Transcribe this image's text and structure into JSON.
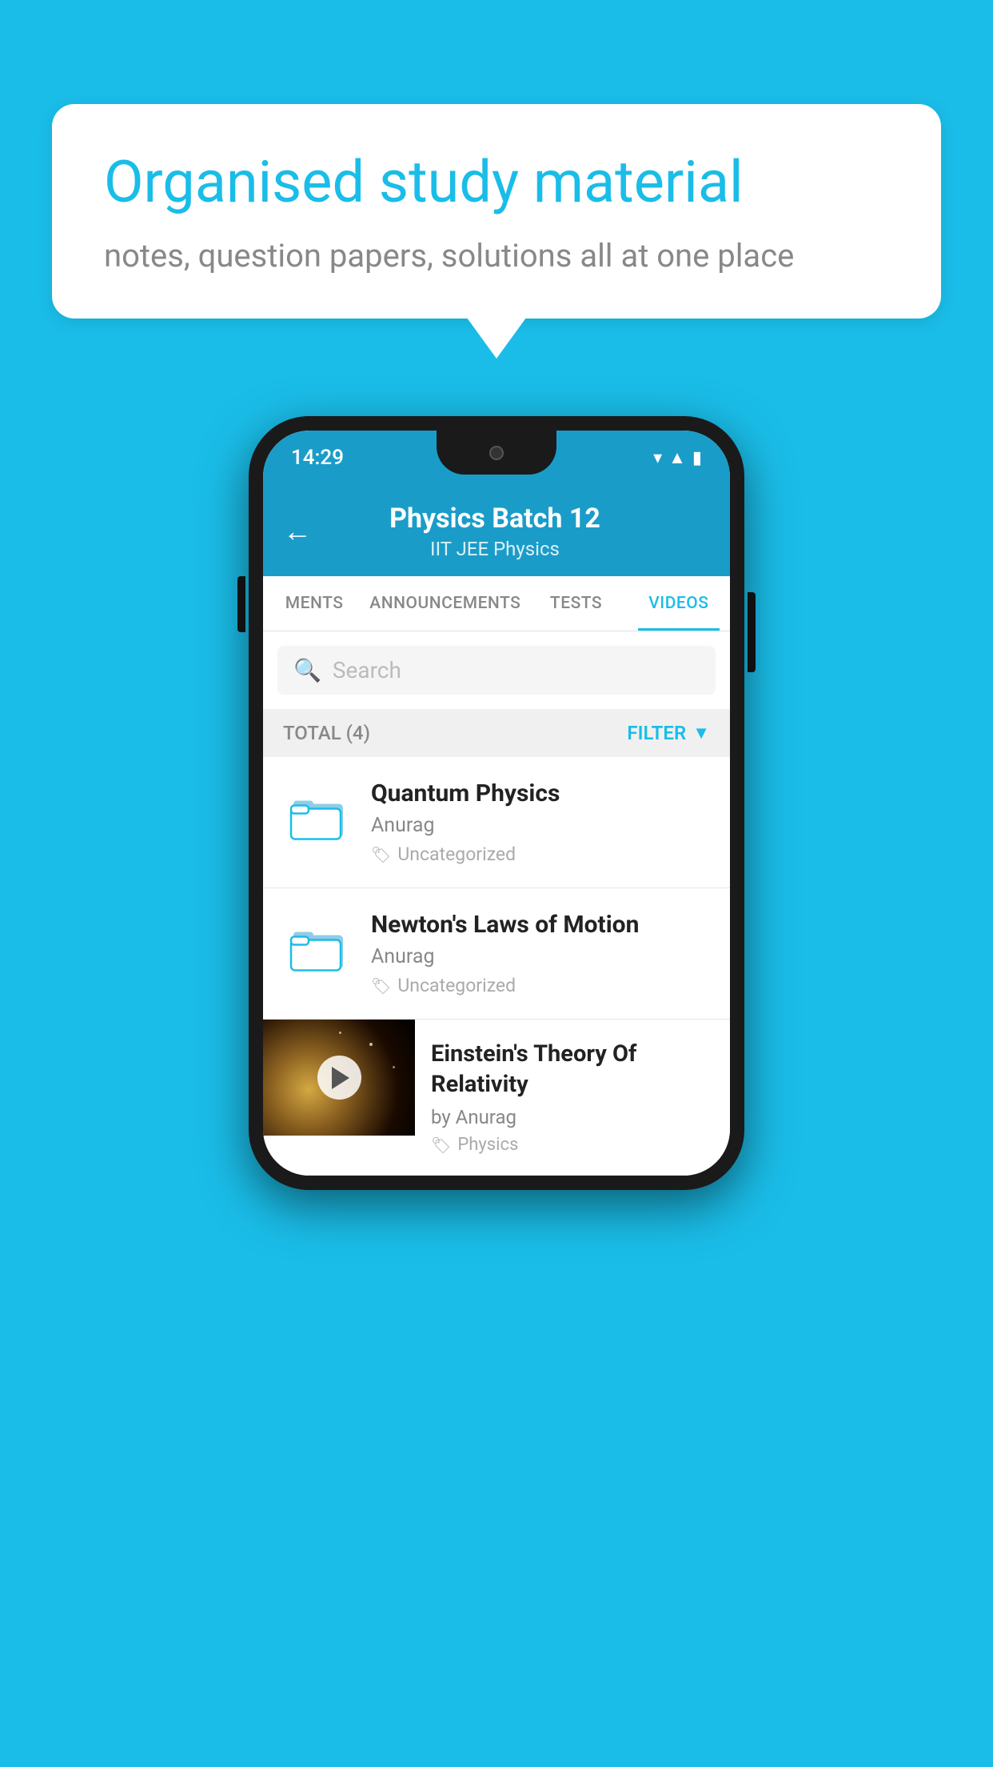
{
  "background_color": "#1abde8",
  "speech_bubble": {
    "title": "Organised study material",
    "subtitle": "notes, question papers, solutions all at one place"
  },
  "phone": {
    "status_bar": {
      "time": "14:29"
    },
    "header": {
      "back_label": "←",
      "title": "Physics Batch 12",
      "subtitle": "IIT JEE   Physics"
    },
    "tabs": [
      {
        "label": "MENTS",
        "active": false
      },
      {
        "label": "ANNOUNCEMENTS",
        "active": false
      },
      {
        "label": "TESTS",
        "active": false
      },
      {
        "label": "VIDEOS",
        "active": true
      }
    ],
    "search": {
      "placeholder": "Search"
    },
    "filter_row": {
      "total_label": "TOTAL (4)",
      "filter_label": "FILTER"
    },
    "videos": [
      {
        "id": 1,
        "title": "Quantum Physics",
        "author": "Anurag",
        "tag": "Uncategorized",
        "type": "folder"
      },
      {
        "id": 2,
        "title": "Newton's Laws of Motion",
        "author": "Anurag",
        "tag": "Uncategorized",
        "type": "folder"
      },
      {
        "id": 3,
        "title": "Einstein's Theory Of Relativity",
        "author": "by Anurag",
        "tag": "Physics",
        "type": "video"
      }
    ]
  }
}
